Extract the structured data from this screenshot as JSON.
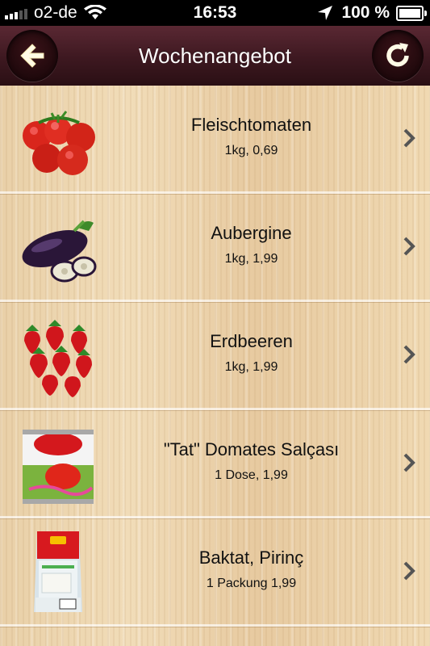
{
  "status_bar": {
    "carrier": "o2-de",
    "time": "16:53",
    "battery": "100 %",
    "battery_level": 1.0,
    "signal_bars_filled": 3,
    "signal_bars_total": 5
  },
  "nav": {
    "title": "Wochenangebot",
    "back_icon": "back-arrow-icon",
    "refresh_icon": "refresh-icon",
    "bar_color": "#3d1820"
  },
  "items": [
    {
      "name": "Fleischtomaten",
      "price": "1kg, 0,69",
      "icon": "tomatoes-image"
    },
    {
      "name": "Aubergine",
      "price": "1kg, 1,99",
      "icon": "eggplant-image"
    },
    {
      "name": "Erdbeeren",
      "price": "1kg, 1,99",
      "icon": "strawberries-image"
    },
    {
      "name": "\"Tat\" Domates Salçası",
      "price": "1 Dose, 1,99",
      "icon": "tomato-paste-can-image"
    },
    {
      "name": "Baktat, Pirinç",
      "price": "1 Packung 1,99",
      "icon": "rice-package-image"
    }
  ],
  "chevron_icon": "chevron-right-icon"
}
